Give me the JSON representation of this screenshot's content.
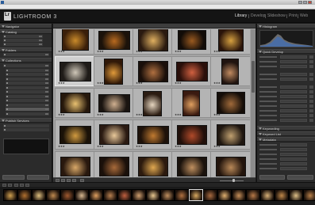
{
  "window": {
    "title": "",
    "controls": [
      "minimize-icon",
      "maximize-icon",
      "close-icon"
    ]
  },
  "menu": [
    "",
    "",
    "",
    "",
    "",
    "",
    "",
    "",
    ""
  ],
  "identity": {
    "adobe_text": "",
    "product_text": "LIGHTROOM 3"
  },
  "modules": [
    {
      "label": "Library",
      "active": true
    },
    {
      "label": "Develop",
      "active": false
    },
    {
      "label": "Slideshow",
      "active": false
    },
    {
      "label": "Print",
      "active": false
    },
    {
      "label": "Web",
      "active": false
    }
  ],
  "left_panel": {
    "navigator": "Navigator",
    "catalog": "Catalog",
    "folders": "Folders",
    "collections": "Collections",
    "publish_services": "Publish Services",
    "import_label": "",
    "export_label": ""
  },
  "filter_bar": {
    "items": [
      {
        "label": "",
        "on": false
      },
      {
        "label": "",
        "on": false
      },
      {
        "label": "",
        "on": false
      },
      {
        "label": "",
        "on": false
      },
      {
        "label": "",
        "on": true
      }
    ]
  },
  "grid": {
    "cell_numbers": [
      "",
      "",
      "",
      "",
      "",
      "",
      "",
      "",
      "",
      "",
      "",
      "",
      "",
      "",
      "",
      "",
      "",
      "",
      "",
      "",
      "",
      "",
      "",
      "",
      ""
    ],
    "star_text": "★★★"
  },
  "right_panel": {
    "histogram": "Histogram",
    "quick_develop": "Quick Develop",
    "keywording": "Keywording",
    "keyword_list": "Keyword List",
    "metadata": "Metadata",
    "sync_label": "",
    "sync_settings_label": ""
  },
  "filmstrip": {
    "path_text": ""
  },
  "colors": {
    "accent": "#d9a13a",
    "panel_bg": "#2b2b2b",
    "grid_bg": "#a3a3a3",
    "selected_cell": "#cfcfcf"
  }
}
